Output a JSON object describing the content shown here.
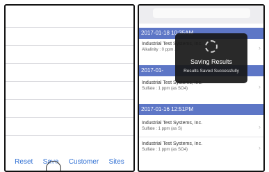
{
  "left_panel": {
    "toolbar": [
      {
        "label": "Reset",
        "name": "reset-button"
      },
      {
        "label": "Save",
        "name": "save-button"
      },
      {
        "label": "Customer",
        "name": "customer-button"
      },
      {
        "label": "Sites",
        "name": "sites-button"
      }
    ]
  },
  "right_panel": {
    "sections": [
      {
        "header": "2017-01-18 10:35AM",
        "entries": [
          {
            "company": "Industrial Test Systems, Inc.",
            "detail": "Alkalinity : 0 ppm ..."
          }
        ]
      },
      {
        "header": "2017-01-",
        "entries": [
          {
            "company": "Industrial Test Systems, Inc.",
            "detail": "Sulfate : 1 ppm (as SO4)"
          }
        ]
      },
      {
        "header": "2017-01-16 12:51PM",
        "entries": [
          {
            "company": "Industrial Test Systems, Inc.",
            "detail": "Sulfate : 1 ppm (as S)"
          },
          {
            "company": "Industrial Test Systems, Inc.",
            "detail": "Sulfate : 1 ppm (as SO4)"
          }
        ]
      }
    ],
    "hud": {
      "title": "Saving Results",
      "subtitle": "Results Saved Successfully"
    }
  },
  "colors": {
    "section_header": "#5d76c6",
    "toolbar_text": "#2f6fd3",
    "hud_background": "#191919"
  },
  "icons": {
    "spinner": "activity-spinner-icon",
    "disclosure": "chevron-right-icon"
  }
}
